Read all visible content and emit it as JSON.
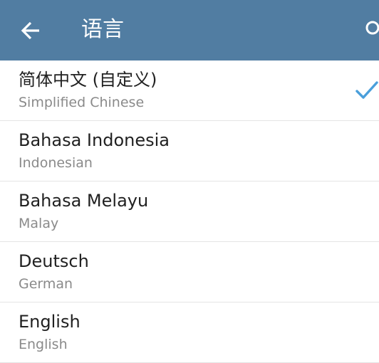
{
  "app_bar": {
    "title": "语言",
    "back_icon": "arrow-left-icon",
    "search_icon": "search-icon",
    "background": "#517da2"
  },
  "languages": [
    {
      "name": "简体中文 (自定义)",
      "subtitle": "Simplified Chinese",
      "selected": true
    },
    {
      "name": "Bahasa Indonesia",
      "subtitle": "Indonesian",
      "selected": false
    },
    {
      "name": "Bahasa Melayu",
      "subtitle": "Malay",
      "selected": false
    },
    {
      "name": "Deutsch",
      "subtitle": "German",
      "selected": false
    },
    {
      "name": "English",
      "subtitle": "English",
      "selected": false
    }
  ],
  "accent_color": "#4a9fdb"
}
